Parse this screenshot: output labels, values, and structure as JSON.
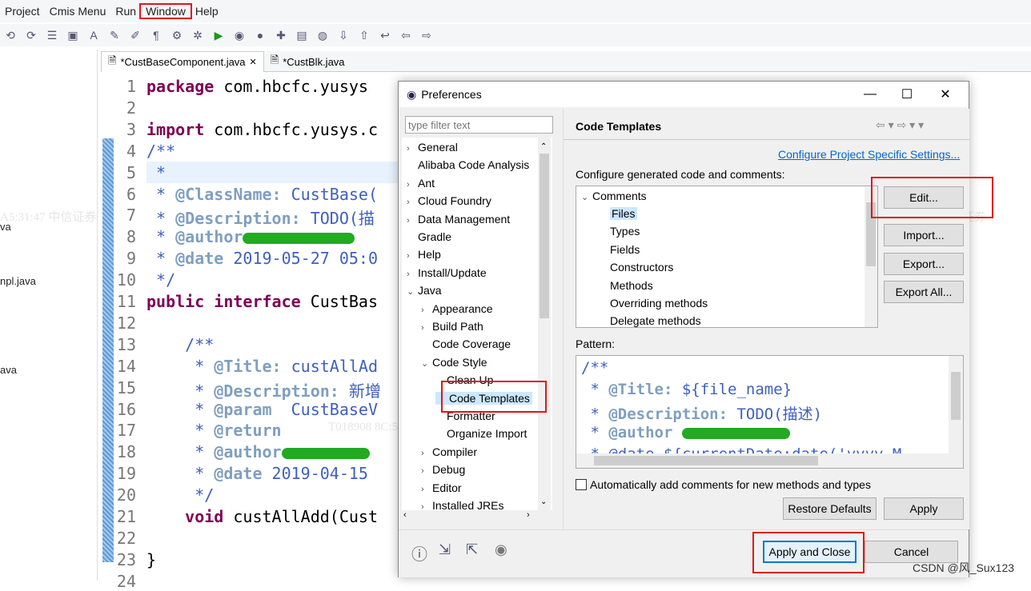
{
  "menu": [
    "Project",
    "Cmis Menu",
    "Run",
    "Window",
    "Help"
  ],
  "left_panel": {
    "items": [
      "va",
      "npl.java",
      "ava"
    ]
  },
  "tabs": [
    {
      "label": "*CustBaseComponent.java",
      "close": "✕"
    },
    {
      "label": "*CustBlk.java"
    }
  ],
  "editor": {
    "lines": [
      "1",
      "2",
      "3",
      "4",
      "5",
      "6",
      "7",
      "8",
      "9",
      "10",
      "11",
      "12",
      "13",
      "14",
      "15",
      "16",
      "17",
      "18",
      "19",
      "20",
      "21",
      "22",
      "23",
      "24"
    ],
    "code": {
      "l1a": "package",
      "l1b": " com.hbcfc.yusys",
      "l3a": "import",
      "l3b": " com.hbcfc.yusys.c",
      "l4": "/**",
      "l5": " *",
      "l6a": " * ",
      "l6b": "@ClassName:",
      "l6c": " CustBase(",
      "l7a": " * ",
      "l7b": "@Description:",
      "l7c": " TODO(描",
      "l8a": " * ",
      "l8b": "@author",
      "l9a": " * ",
      "l9b": "@date",
      "l9c": " 2019-05-27 05:0",
      "l10": " */",
      "l11a": "public interface",
      "l11b": " CustBas",
      "l13": "    /**",
      "l14a": "     * ",
      "l14b": "@Title:",
      "l14c": " custAllAd",
      "l15a": "     * ",
      "l15b": "@Description:",
      "l15c": " 新增",
      "l16a": "     * ",
      "l16b": "@param",
      "l16c": "  CustBaseV",
      "l17a": "     * ",
      "l17b": "@return",
      "l18a": "     * ",
      "l18b": "@author",
      "l19a": "     * ",
      "l19b": "@date",
      "l19c": " 2019-04-15",
      "l20": "     */",
      "l21a": "    void",
      "l21b": " custAllAdd(Cust",
      "l23": "}"
    }
  },
  "dialog": {
    "title": "Preferences",
    "filter_placeholder": "type filter text",
    "tree": [
      {
        "label": "General",
        "arrow": "›",
        "indent": 0
      },
      {
        "label": "Alibaba Code Analysis",
        "arrow": "",
        "indent": 0
      },
      {
        "label": "Ant",
        "arrow": "›",
        "indent": 0
      },
      {
        "label": "Cloud Foundry",
        "arrow": "›",
        "indent": 0
      },
      {
        "label": "Data Management",
        "arrow": "›",
        "indent": 0
      },
      {
        "label": "Gradle",
        "arrow": "",
        "indent": 0
      },
      {
        "label": "Help",
        "arrow": "›",
        "indent": 0
      },
      {
        "label": "Install/Update",
        "arrow": "›",
        "indent": 0
      },
      {
        "label": "Java",
        "arrow": "⌄",
        "indent": 0
      },
      {
        "label": "Appearance",
        "arrow": "›",
        "indent": 1
      },
      {
        "label": "Build Path",
        "arrow": "›",
        "indent": 1
      },
      {
        "label": "Code Coverage",
        "arrow": "",
        "indent": 1
      },
      {
        "label": "Code Style",
        "arrow": "⌄",
        "indent": 1
      },
      {
        "label": "Clean Up",
        "arrow": "",
        "indent": 2
      },
      {
        "label": "Code Templates",
        "arrow": "",
        "indent": 2,
        "selected": true
      },
      {
        "label": "Formatter",
        "arrow": "",
        "indent": 2
      },
      {
        "label": "Organize Import",
        "arrow": "",
        "indent": 2
      },
      {
        "label": "Compiler",
        "arrow": "›",
        "indent": 1
      },
      {
        "label": "Debug",
        "arrow": "›",
        "indent": 1
      },
      {
        "label": "Editor",
        "arrow": "›",
        "indent": 1
      },
      {
        "label": "Installed JREs",
        "arrow": "›",
        "indent": 1
      }
    ],
    "page_title": "Code Templates",
    "configure_link": "Configure Project Specific Settings...",
    "configure_label": "Configure generated code and comments:",
    "comments_root": "Comments",
    "comment_items": [
      "Files",
      "Types",
      "Fields",
      "Constructors",
      "Methods",
      "Overriding methods",
      "Delegate methods"
    ],
    "buttons": {
      "edit": "Edit...",
      "import": "Import...",
      "export": "Export...",
      "export_all": "Export All...",
      "restore": "Restore Defaults",
      "apply": "Apply",
      "apply_close": "Apply and Close",
      "cancel": "Cancel"
    },
    "pattern_label": "Pattern:",
    "pattern": {
      "p1": "/**",
      "p2a": " * ",
      "p2b": "@Title:",
      "p2c": " ${file_name}",
      "p3a": " * ",
      "p3b": "@Description:",
      "p3c": " TODO(描述)",
      "p4a": " * ",
      "p4b": "@author",
      "p5": " * @date ${currentDate:date('yyyy-M"
    },
    "auto_comments_label": "Automatically add comments for new methods and types",
    "auto_comments_checked": false
  },
  "watermark": {
    "text1": "T018908   8C:55:4A:A5:31:47   中信证券",
    "text2": "A5:31:47   中信证券"
  },
  "credit": "CSDN @风_Sux123",
  "colors": {
    "highlight": "#e0141e",
    "keyword": "#7f0055",
    "comment": "#3f5fbf",
    "link": "#0066cc"
  }
}
